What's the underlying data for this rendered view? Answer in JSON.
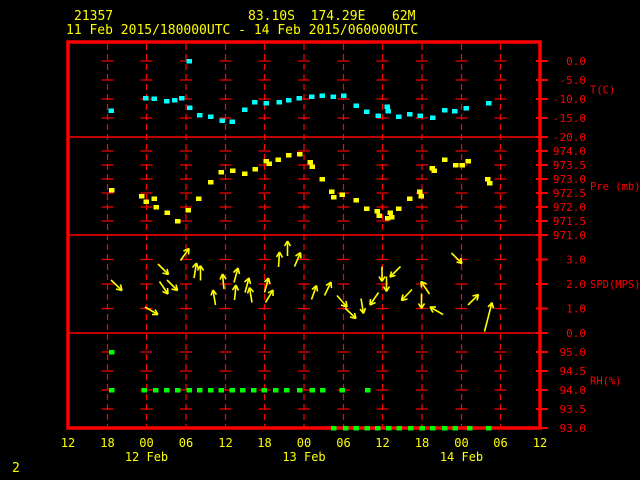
{
  "header": {
    "station_id": "21357",
    "location": "83.10S  174.29E",
    "elevation": "62M",
    "time_range": "11 Feb 2015/180000UTC - 14 Feb 2015/060000UTC"
  },
  "page_number": "2",
  "colors": {
    "background": "#000000",
    "frame": "#ff0000",
    "axis_text": "#ff0000",
    "header_text": "#ffff00",
    "temperature": "#00ffff",
    "pressure": "#ffff00",
    "wind": "#ffff00",
    "humidity": "#00ff00"
  },
  "x_axis": {
    "hours_span": 72,
    "tick_interval_hours": 6,
    "tick_labels": [
      "12",
      "18",
      "00",
      "06",
      "12",
      "18",
      "00",
      "06",
      "12",
      "18",
      "00",
      "06",
      "12"
    ],
    "date_labels": [
      {
        "label": "12 Feb",
        "tick_index": 2
      },
      {
        "label": "13 Feb",
        "tick_index": 6
      },
      {
        "label": "14 Feb",
        "tick_index": 10
      }
    ]
  },
  "chart_data": [
    {
      "type": "scatter",
      "name": "temperature",
      "ylabel": "T(C)",
      "color_key": "temperature",
      "ylim": [
        -20,
        5
      ],
      "yticks": [
        0,
        -5,
        -10,
        -15,
        -20
      ],
      "ytick_labels": [
        "0.0",
        "-5.0",
        "-10.0",
        "-15.0",
        "-20.0"
      ],
      "ylabel_at": -7.5,
      "panel_top": 42,
      "panel_bottom": 137,
      "points": [
        [
          6.6,
          -13.0
        ],
        [
          11.9,
          -9.8
        ],
        [
          13.2,
          -9.9
        ],
        [
          15.1,
          -10.5
        ],
        [
          16.3,
          -10.3
        ],
        [
          17.4,
          -9.8
        ],
        [
          18.5,
          0.0
        ],
        [
          18.6,
          -12.2
        ],
        [
          20.1,
          -14.2
        ],
        [
          21.8,
          -14.6
        ],
        [
          23.6,
          -15.7
        ],
        [
          25.1,
          -15.9
        ],
        [
          27.0,
          -12.8
        ],
        [
          28.5,
          -10.8
        ],
        [
          30.3,
          -11.1
        ],
        [
          32.3,
          -10.8
        ],
        [
          33.7,
          -10.2
        ],
        [
          35.3,
          -9.7
        ],
        [
          37.2,
          -9.3
        ],
        [
          38.8,
          -9.1
        ],
        [
          40.5,
          -9.3
        ],
        [
          42.1,
          -9.1
        ],
        [
          44.0,
          -11.7
        ],
        [
          45.6,
          -13.3
        ],
        [
          47.4,
          -14.4
        ],
        [
          48.7,
          -12.0
        ],
        [
          48.9,
          -13.2
        ],
        [
          50.5,
          -14.6
        ],
        [
          52.2,
          -13.9
        ],
        [
          53.8,
          -14.4
        ],
        [
          55.7,
          -14.9
        ],
        [
          57.5,
          -12.9
        ],
        [
          59.0,
          -13.2
        ],
        [
          60.8,
          -12.4
        ],
        [
          64.2,
          -11.1
        ]
      ]
    },
    {
      "type": "scatter",
      "name": "pressure",
      "ylabel": "Pre (mb)",
      "color_key": "pressure",
      "ylim": [
        971.0,
        974.5
      ],
      "yticks": [
        974.0,
        973.5,
        973.0,
        972.5,
        972.0,
        971.5,
        971.0
      ],
      "ytick_labels": [
        "974.0",
        "973.5",
        "973.0",
        "972.5",
        "972.0",
        "971.5",
        "971.0"
      ],
      "ylabel_at": 972.75,
      "panel_top": 137,
      "panel_bottom": 235,
      "points": [
        [
          6.7,
          972.6
        ],
        [
          11.3,
          972.4
        ],
        [
          12.0,
          972.2
        ],
        [
          13.2,
          972.3
        ],
        [
          13.5,
          972.0
        ],
        [
          15.2,
          971.8
        ],
        [
          16.8,
          971.5
        ],
        [
          18.4,
          971.9
        ],
        [
          20.0,
          972.3
        ],
        [
          21.8,
          972.9
        ],
        [
          23.4,
          973.25
        ],
        [
          25.2,
          973.3
        ],
        [
          27.0,
          973.2
        ],
        [
          28.6,
          973.35
        ],
        [
          30.3,
          973.65
        ],
        [
          30.7,
          973.55
        ],
        [
          32.1,
          973.7
        ],
        [
          33.7,
          973.85
        ],
        [
          35.4,
          973.9
        ],
        [
          37.0,
          973.6
        ],
        [
          37.3,
          973.45
        ],
        [
          38.8,
          973.0
        ],
        [
          40.3,
          972.55
        ],
        [
          40.6,
          972.35
        ],
        [
          41.9,
          972.45
        ],
        [
          44.0,
          972.25
        ],
        [
          45.6,
          971.95
        ],
        [
          47.2,
          971.85
        ],
        [
          47.5,
          971.7
        ],
        [
          48.8,
          971.6
        ],
        [
          49.2,
          971.8
        ],
        [
          49.4,
          971.65
        ],
        [
          50.5,
          971.95
        ],
        [
          52.2,
          972.3
        ],
        [
          53.7,
          972.55
        ],
        [
          53.9,
          972.4
        ],
        [
          55.6,
          973.4
        ],
        [
          55.9,
          973.3
        ],
        [
          57.5,
          973.7
        ],
        [
          59.2,
          973.5
        ],
        [
          60.2,
          973.5
        ],
        [
          61.1,
          973.65
        ],
        [
          64.1,
          973.0
        ],
        [
          64.4,
          972.85
        ]
      ]
    },
    {
      "type": "vector",
      "name": "wind",
      "ylabel": "SPD(MPS)",
      "color_key": "wind",
      "ylim": [
        0,
        4
      ],
      "yticks": [
        3,
        2,
        1,
        0
      ],
      "ytick_labels": [
        "3.0",
        "2.0",
        "1.0",
        "0.0"
      ],
      "ylabel_at": 2.0,
      "panel_top": 235,
      "panel_bottom": 333,
      "arrows": [
        [
          7.4,
          1.95,
          135
        ],
        [
          12.7,
          0.9,
          120
        ],
        [
          14.5,
          2.6,
          135
        ],
        [
          14.6,
          1.85,
          145
        ],
        [
          15.9,
          1.95,
          135
        ],
        [
          17.8,
          3.2,
          35
        ],
        [
          19.4,
          2.55,
          10
        ],
        [
          20.2,
          2.45,
          0
        ],
        [
          22.3,
          1.45,
          -10
        ],
        [
          23.7,
          2.1,
          -5
        ],
        [
          25.6,
          2.35,
          15
        ],
        [
          25.5,
          1.65,
          5
        ],
        [
          27.3,
          1.95,
          15
        ],
        [
          27.9,
          1.55,
          -10
        ],
        [
          30.3,
          1.95,
          15
        ],
        [
          30.7,
          1.5,
          30
        ],
        [
          32.2,
          3.0,
          5
        ],
        [
          33.5,
          3.45,
          0
        ],
        [
          35.0,
          3.0,
          25
        ],
        [
          37.5,
          1.65,
          20
        ],
        [
          39.6,
          1.8,
          25
        ],
        [
          41.8,
          1.3,
          140
        ],
        [
          43.1,
          0.8,
          135
        ],
        [
          44.9,
          1.1,
          170
        ],
        [
          46.7,
          1.4,
          215
        ],
        [
          47.9,
          2.4,
          180
        ],
        [
          48.6,
          2.0,
          180
        ],
        [
          49.9,
          2.5,
          225
        ],
        [
          51.7,
          1.55,
          225
        ],
        [
          53.9,
          1.3,
          180
        ],
        [
          54.5,
          1.85,
          325
        ],
        [
          56.2,
          0.9,
          300
        ],
        [
          59.3,
          3.05,
          135
        ],
        [
          61.8,
          1.35,
          45
        ],
        [
          64.1,
          0.65,
          15,
          30
        ]
      ]
    },
    {
      "type": "scatter",
      "name": "humidity",
      "ylabel": "RH(%)",
      "color_key": "humidity",
      "ylim": [
        93.0,
        95.5
      ],
      "yticks": [
        95.0,
        94.5,
        94.0,
        93.5,
        93.0
      ],
      "ytick_labels": [
        "95.0",
        "94.5",
        "94.0",
        "93.5",
        "93.0"
      ],
      "ylabel_at": 94.25,
      "panel_top": 333,
      "panel_bottom": 428,
      "points": [
        [
          6.7,
          95.0
        ],
        [
          6.7,
          94.0
        ],
        [
          11.7,
          94.0
        ],
        [
          13.4,
          94.0
        ],
        [
          15.1,
          94.0
        ],
        [
          16.8,
          94.0
        ],
        [
          18.5,
          94.0
        ],
        [
          20.1,
          94.0
        ],
        [
          21.8,
          94.0
        ],
        [
          23.4,
          94.0
        ],
        [
          25.1,
          94.0
        ],
        [
          26.7,
          94.0
        ],
        [
          28.4,
          94.0
        ],
        [
          30.0,
          94.0
        ],
        [
          31.7,
          94.0
        ],
        [
          33.4,
          94.0
        ],
        [
          35.4,
          94.0
        ],
        [
          37.3,
          94.0
        ],
        [
          38.9,
          94.0
        ],
        [
          41.9,
          94.0
        ],
        [
          45.8,
          94.0
        ],
        [
          40.6,
          93.0
        ],
        [
          42.4,
          93.0
        ],
        [
          44.0,
          93.0
        ],
        [
          45.7,
          93.0
        ],
        [
          47.3,
          93.0
        ],
        [
          49.0,
          93.0
        ],
        [
          50.6,
          93.0
        ],
        [
          52.3,
          93.0
        ],
        [
          54.1,
          93.0
        ],
        [
          55.7,
          93.0
        ],
        [
          57.5,
          93.0
        ],
        [
          59.1,
          93.0
        ],
        [
          61.3,
          93.0
        ],
        [
          64.2,
          93.0
        ]
      ]
    }
  ]
}
